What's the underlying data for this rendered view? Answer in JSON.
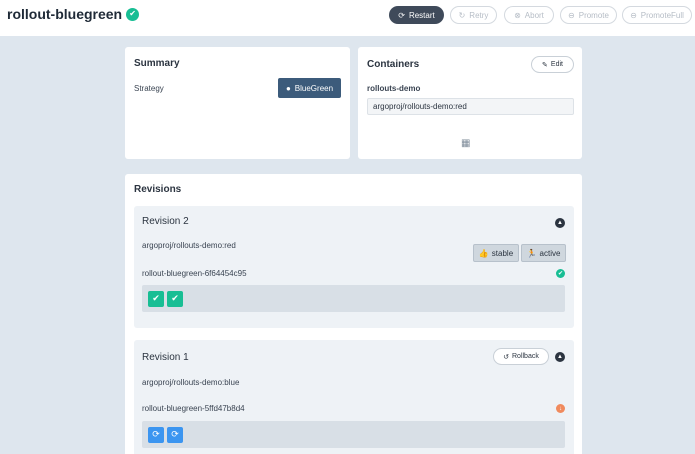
{
  "header": {
    "title": "rollout-bluegreen",
    "status_icon": "check-circle-icon",
    "buttons": [
      {
        "label": "Restart",
        "icon": "restart-icon",
        "enabled": true
      },
      {
        "label": "Retry",
        "icon": "retry-icon",
        "enabled": false
      },
      {
        "label": "Abort",
        "icon": "abort-icon",
        "enabled": false
      },
      {
        "label": "Promote",
        "icon": "promote-icon",
        "enabled": false
      },
      {
        "label": "PromoteFull",
        "icon": "promote-full-icon",
        "enabled": false
      }
    ]
  },
  "summary": {
    "title": "Summary",
    "strategy_label": "Strategy",
    "strategy_value": "BlueGreen"
  },
  "containers": {
    "title": "Containers",
    "edit_label": "Edit",
    "container_name": "rollouts-demo",
    "image": "argoproj/rollouts-demo:red",
    "footer_icon": "boxes-icon"
  },
  "revisions": {
    "title": "Revisions",
    "items": [
      {
        "title": "Revision 2",
        "image": "argoproj/rollouts-demo:red",
        "tags": [
          "stable",
          "active"
        ],
        "replicaset": "rollout-bluegreen-6f64454c95",
        "status": "healthy",
        "pods": [
          "ok",
          "ok"
        ]
      },
      {
        "title": "Revision 1",
        "image": "argoproj/rollouts-demo:blue",
        "rollback_label": "Rollback",
        "replicaset": "rollout-bluegreen-5ffd47b8d4",
        "status": "scaled-down",
        "pods": [
          "progressing",
          "progressing"
        ]
      }
    ]
  },
  "colors": {
    "healthy": "#18be94",
    "scaled_down": "#f08a5d",
    "progressing": "#3b95f0",
    "primary_button": "#3f4a5a",
    "bluegreen_badge": "#3c5b7b"
  }
}
